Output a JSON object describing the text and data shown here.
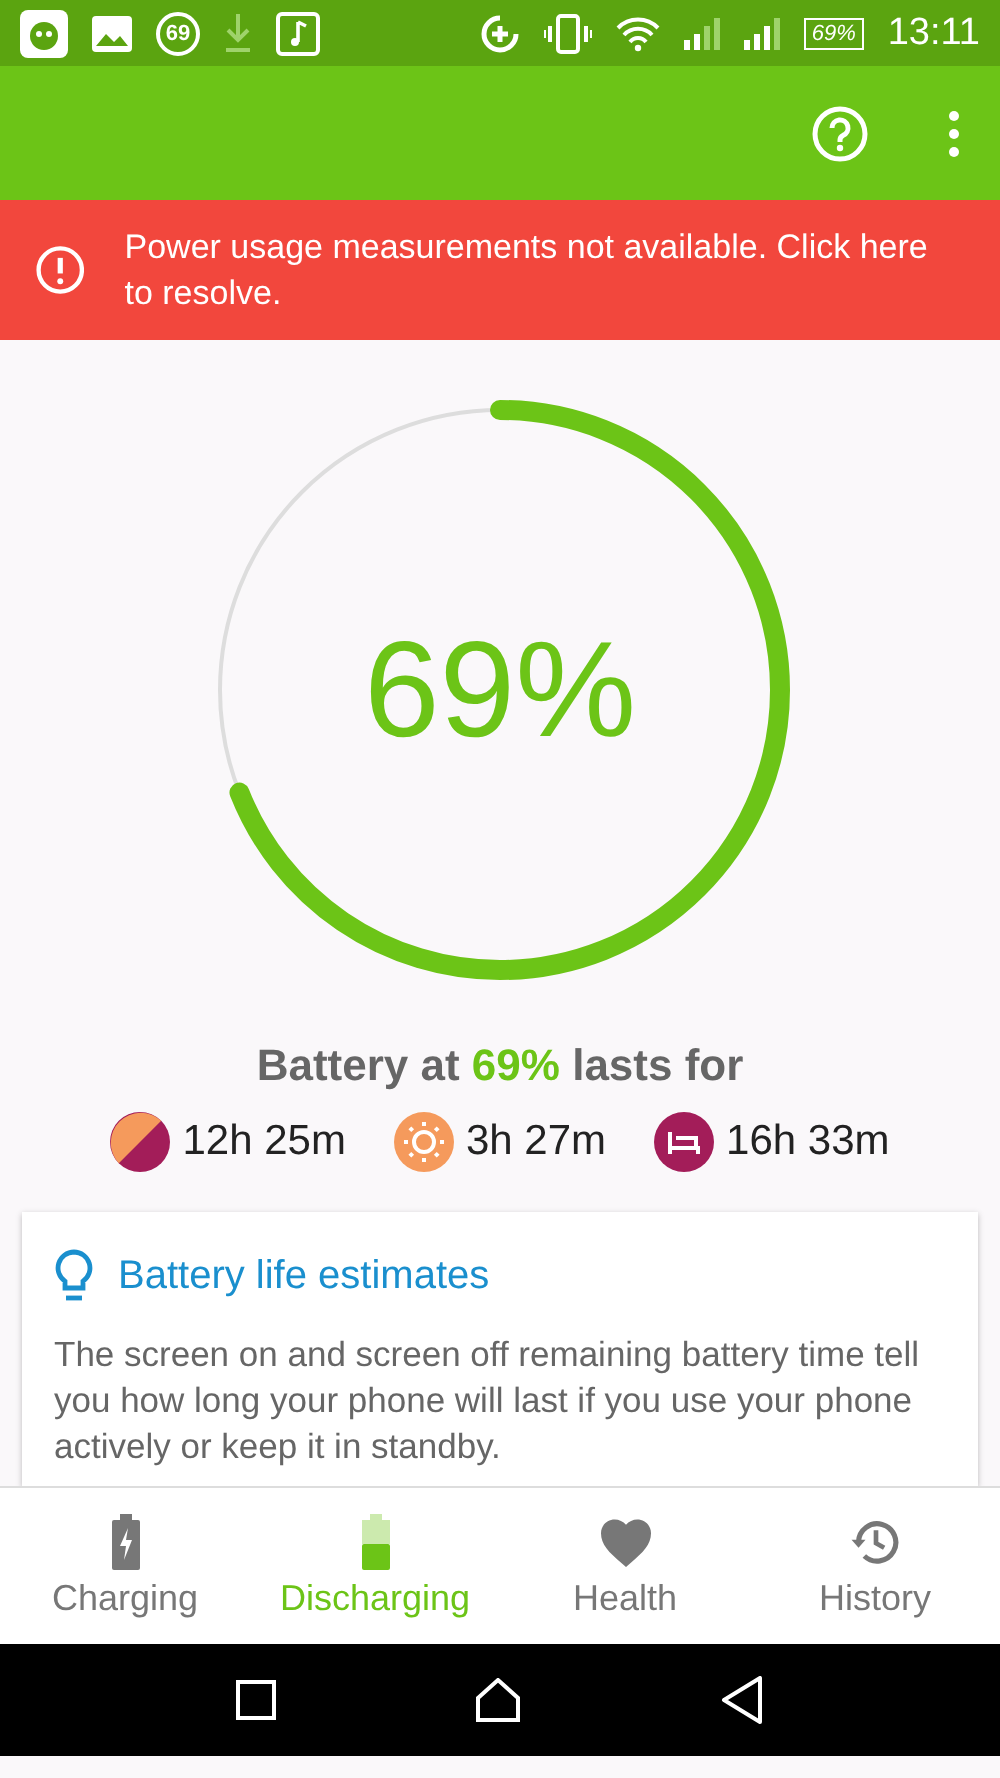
{
  "status_bar": {
    "notification_count": "69",
    "battery": "69%",
    "time": "13:11"
  },
  "banner": {
    "text": "Power usage measurements not available. Click here to resolve."
  },
  "gauge": {
    "level": 0.69,
    "reading": "69%"
  },
  "summary": {
    "title": "Battery at **69%** lasts for",
    "estimates": [
      {
        "kind": "mixed",
        "value": "12h 25m"
      },
      {
        "kind": "screen_on",
        "value": "3h 27m"
      },
      {
        "kind": "standby",
        "value": "16h 33m"
      }
    ]
  },
  "card": {
    "title": "Battery life estimates",
    "text": "The screen on and screen off remaining battery time tell you how long your phone will last if you use your phone actively or keep it in standby."
  },
  "tabs": [
    {
      "kind": "charging",
      "label": "Charging",
      "selected": false
    },
    {
      "kind": "discharging",
      "label": "Discharging",
      "selected": true
    },
    {
      "kind": "health",
      "label": "Health",
      "selected": false
    },
    {
      "kind": "history",
      "label": "History",
      "selected": false
    }
  ]
}
